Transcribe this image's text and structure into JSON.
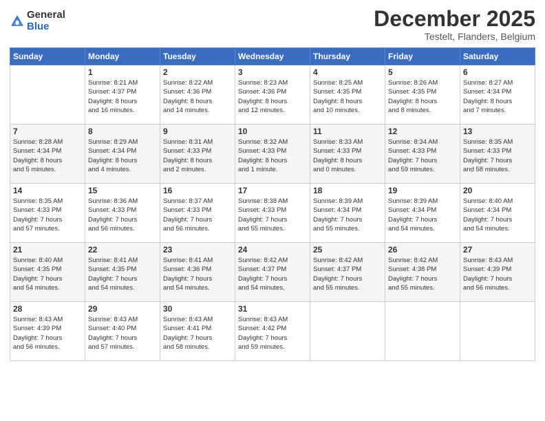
{
  "logo": {
    "general": "General",
    "blue": "Blue"
  },
  "header": {
    "month": "December 2025",
    "location": "Testelt, Flanders, Belgium"
  },
  "weekdays": [
    "Sunday",
    "Monday",
    "Tuesday",
    "Wednesday",
    "Thursday",
    "Friday",
    "Saturday"
  ],
  "weeks": [
    [
      {
        "day": "",
        "info": ""
      },
      {
        "day": "1",
        "info": "Sunrise: 8:21 AM\nSunset: 4:37 PM\nDaylight: 8 hours\nand 16 minutes."
      },
      {
        "day": "2",
        "info": "Sunrise: 8:22 AM\nSunset: 4:36 PM\nDaylight: 8 hours\nand 14 minutes."
      },
      {
        "day": "3",
        "info": "Sunrise: 8:23 AM\nSunset: 4:36 PM\nDaylight: 8 hours\nand 12 minutes."
      },
      {
        "day": "4",
        "info": "Sunrise: 8:25 AM\nSunset: 4:35 PM\nDaylight: 8 hours\nand 10 minutes."
      },
      {
        "day": "5",
        "info": "Sunrise: 8:26 AM\nSunset: 4:35 PM\nDaylight: 8 hours\nand 8 minutes."
      },
      {
        "day": "6",
        "info": "Sunrise: 8:27 AM\nSunset: 4:34 PM\nDaylight: 8 hours\nand 7 minutes."
      }
    ],
    [
      {
        "day": "7",
        "info": "Sunrise: 8:28 AM\nSunset: 4:34 PM\nDaylight: 8 hours\nand 5 minutes."
      },
      {
        "day": "8",
        "info": "Sunrise: 8:29 AM\nSunset: 4:34 PM\nDaylight: 8 hours\nand 4 minutes."
      },
      {
        "day": "9",
        "info": "Sunrise: 8:31 AM\nSunset: 4:33 PM\nDaylight: 8 hours\nand 2 minutes."
      },
      {
        "day": "10",
        "info": "Sunrise: 8:32 AM\nSunset: 4:33 PM\nDaylight: 8 hours\nand 1 minute."
      },
      {
        "day": "11",
        "info": "Sunrise: 8:33 AM\nSunset: 4:33 PM\nDaylight: 8 hours\nand 0 minutes."
      },
      {
        "day": "12",
        "info": "Sunrise: 8:34 AM\nSunset: 4:33 PM\nDaylight: 7 hours\nand 59 minutes."
      },
      {
        "day": "13",
        "info": "Sunrise: 8:35 AM\nSunset: 4:33 PM\nDaylight: 7 hours\nand 58 minutes."
      }
    ],
    [
      {
        "day": "14",
        "info": "Sunrise: 8:35 AM\nSunset: 4:33 PM\nDaylight: 7 hours\nand 57 minutes."
      },
      {
        "day": "15",
        "info": "Sunrise: 8:36 AM\nSunset: 4:33 PM\nDaylight: 7 hours\nand 56 minutes."
      },
      {
        "day": "16",
        "info": "Sunrise: 8:37 AM\nSunset: 4:33 PM\nDaylight: 7 hours\nand 56 minutes."
      },
      {
        "day": "17",
        "info": "Sunrise: 8:38 AM\nSunset: 4:33 PM\nDaylight: 7 hours\nand 55 minutes."
      },
      {
        "day": "18",
        "info": "Sunrise: 8:39 AM\nSunset: 4:34 PM\nDaylight: 7 hours\nand 55 minutes."
      },
      {
        "day": "19",
        "info": "Sunrise: 8:39 AM\nSunset: 4:34 PM\nDaylight: 7 hours\nand 54 minutes."
      },
      {
        "day": "20",
        "info": "Sunrise: 8:40 AM\nSunset: 4:34 PM\nDaylight: 7 hours\nand 54 minutes."
      }
    ],
    [
      {
        "day": "21",
        "info": "Sunrise: 8:40 AM\nSunset: 4:35 PM\nDaylight: 7 hours\nand 54 minutes."
      },
      {
        "day": "22",
        "info": "Sunrise: 8:41 AM\nSunset: 4:35 PM\nDaylight: 7 hours\nand 54 minutes."
      },
      {
        "day": "23",
        "info": "Sunrise: 8:41 AM\nSunset: 4:36 PM\nDaylight: 7 hours\nand 54 minutes."
      },
      {
        "day": "24",
        "info": "Sunrise: 8:42 AM\nSunset: 4:37 PM\nDaylight: 7 hours\nand 54 minutes."
      },
      {
        "day": "25",
        "info": "Sunrise: 8:42 AM\nSunset: 4:37 PM\nDaylight: 7 hours\nand 55 minutes."
      },
      {
        "day": "26",
        "info": "Sunrise: 8:42 AM\nSunset: 4:38 PM\nDaylight: 7 hours\nand 55 minutes."
      },
      {
        "day": "27",
        "info": "Sunrise: 8:43 AM\nSunset: 4:39 PM\nDaylight: 7 hours\nand 56 minutes."
      }
    ],
    [
      {
        "day": "28",
        "info": "Sunrise: 8:43 AM\nSunset: 4:39 PM\nDaylight: 7 hours\nand 56 minutes."
      },
      {
        "day": "29",
        "info": "Sunrise: 8:43 AM\nSunset: 4:40 PM\nDaylight: 7 hours\nand 57 minutes."
      },
      {
        "day": "30",
        "info": "Sunrise: 8:43 AM\nSunset: 4:41 PM\nDaylight: 7 hours\nand 58 minutes."
      },
      {
        "day": "31",
        "info": "Sunrise: 8:43 AM\nSunset: 4:42 PM\nDaylight: 7 hours\nand 59 minutes."
      },
      {
        "day": "",
        "info": ""
      },
      {
        "day": "",
        "info": ""
      },
      {
        "day": "",
        "info": ""
      }
    ]
  ]
}
